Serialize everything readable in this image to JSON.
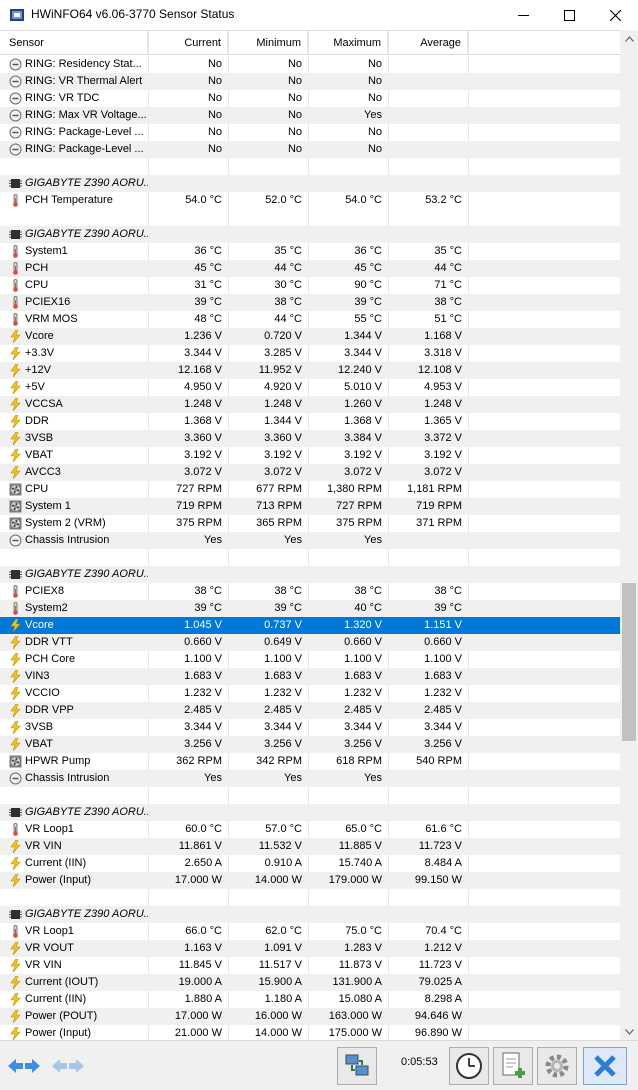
{
  "window": {
    "title": "HWiNFO64 v6.06-3770 Sensor Status"
  },
  "columns": {
    "sensor": "Sensor",
    "current": "Current",
    "minimum": "Minimum",
    "maximum": "Maximum",
    "average": "Average"
  },
  "rows": [
    {
      "type": "item",
      "icon": "status-circle-icon",
      "name": "RING: Residency Stat...",
      "cur": "No",
      "min": "No",
      "max": "No",
      "avg": ""
    },
    {
      "type": "item",
      "icon": "status-circle-icon",
      "name": "RING: VR Thermal Alert",
      "cur": "No",
      "min": "No",
      "max": "No",
      "avg": ""
    },
    {
      "type": "item",
      "icon": "status-circle-icon",
      "name": "RING: VR TDC",
      "cur": "No",
      "min": "No",
      "max": "No",
      "avg": ""
    },
    {
      "type": "item",
      "icon": "status-circle-icon",
      "name": "RING: Max VR Voltage...",
      "cur": "No",
      "min": "No",
      "max": "Yes",
      "avg": ""
    },
    {
      "type": "item",
      "icon": "status-circle-icon",
      "name": "RING: Package-Level ...",
      "cur": "No",
      "min": "No",
      "max": "No",
      "avg": ""
    },
    {
      "type": "item",
      "icon": "status-circle-icon",
      "name": "RING: Package-Level ...",
      "cur": "No",
      "min": "No",
      "max": "No",
      "avg": ""
    },
    {
      "type": "blank"
    },
    {
      "type": "group",
      "icon": "chip-icon",
      "name": "GIGABYTE Z390 AORU..."
    },
    {
      "type": "item",
      "icon": "thermometer-icon",
      "name": "PCH Temperature",
      "cur": "54.0 °C",
      "min": "52.0 °C",
      "max": "54.0 °C",
      "avg": "53.2 °C"
    },
    {
      "type": "blank"
    },
    {
      "type": "group",
      "icon": "chip-icon",
      "name": "GIGABYTE Z390 AORU..."
    },
    {
      "type": "item",
      "icon": "thermometer-icon",
      "name": "System1",
      "cur": "36 °C",
      "min": "35 °C",
      "max": "36 °C",
      "avg": "35 °C"
    },
    {
      "type": "item",
      "icon": "thermometer-icon",
      "name": "PCH",
      "cur": "45 °C",
      "min": "44 °C",
      "max": "45 °C",
      "avg": "44 °C"
    },
    {
      "type": "item",
      "icon": "thermometer-icon",
      "name": "CPU",
      "cur": "31 °C",
      "min": "30 °C",
      "max": "90 °C",
      "avg": "71 °C"
    },
    {
      "type": "item",
      "icon": "thermometer-icon",
      "name": "PCIEX16",
      "cur": "39 °C",
      "min": "38 °C",
      "max": "39 °C",
      "avg": "38 °C"
    },
    {
      "type": "item",
      "icon": "thermometer-icon",
      "name": "VRM MOS",
      "cur": "48 °C",
      "min": "44 °C",
      "max": "55 °C",
      "avg": "51 °C"
    },
    {
      "type": "item",
      "icon": "bolt-icon",
      "name": "Vcore",
      "cur": "1.236 V",
      "min": "0.720 V",
      "max": "1.344 V",
      "avg": "1.168 V"
    },
    {
      "type": "item",
      "icon": "bolt-icon",
      "name": "+3.3V",
      "cur": "3.344 V",
      "min": "3.285 V",
      "max": "3.344 V",
      "avg": "3.318 V"
    },
    {
      "type": "item",
      "icon": "bolt-icon",
      "name": "+12V",
      "cur": "12.168 V",
      "min": "11.952 V",
      "max": "12.240 V",
      "avg": "12.108 V"
    },
    {
      "type": "item",
      "icon": "bolt-icon",
      "name": "+5V",
      "cur": "4.950 V",
      "min": "4.920 V",
      "max": "5.010 V",
      "avg": "4.953 V"
    },
    {
      "type": "item",
      "icon": "bolt-icon",
      "name": "VCCSA",
      "cur": "1.248 V",
      "min": "1.248 V",
      "max": "1.260 V",
      "avg": "1.248 V"
    },
    {
      "type": "item",
      "icon": "bolt-icon",
      "name": "DDR",
      "cur": "1.368 V",
      "min": "1.344 V",
      "max": "1.368 V",
      "avg": "1.365 V"
    },
    {
      "type": "item",
      "icon": "bolt-icon",
      "name": "3VSB",
      "cur": "3.360 V",
      "min": "3.360 V",
      "max": "3.384 V",
      "avg": "3.372 V"
    },
    {
      "type": "item",
      "icon": "bolt-icon",
      "name": "VBAT",
      "cur": "3.192 V",
      "min": "3.192 V",
      "max": "3.192 V",
      "avg": "3.192 V"
    },
    {
      "type": "item",
      "icon": "bolt-icon",
      "name": "AVCC3",
      "cur": "3.072 V",
      "min": "3.072 V",
      "max": "3.072 V",
      "avg": "3.072 V"
    },
    {
      "type": "item",
      "icon": "fan-icon",
      "name": "CPU",
      "cur": "727 RPM",
      "min": "677 RPM",
      "max": "1,380 RPM",
      "avg": "1,181 RPM"
    },
    {
      "type": "item",
      "icon": "fan-icon",
      "name": "System 1",
      "cur": "719 RPM",
      "min": "713 RPM",
      "max": "727 RPM",
      "avg": "719 RPM"
    },
    {
      "type": "item",
      "icon": "fan-icon",
      "name": "System 2 (VRM)",
      "cur": "375 RPM",
      "min": "365 RPM",
      "max": "375 RPM",
      "avg": "371 RPM"
    },
    {
      "type": "item",
      "icon": "status-circle-icon",
      "name": "Chassis Intrusion",
      "cur": "Yes",
      "min": "Yes",
      "max": "Yes",
      "avg": ""
    },
    {
      "type": "blank"
    },
    {
      "type": "group",
      "icon": "chip-icon",
      "name": "GIGABYTE Z390 AORU..."
    },
    {
      "type": "item",
      "icon": "thermometer-icon",
      "name": "PCIEX8",
      "cur": "38 °C",
      "min": "38 °C",
      "max": "38 °C",
      "avg": "38 °C"
    },
    {
      "type": "item",
      "icon": "thermometer-icon",
      "name": "System2",
      "cur": "39 °C",
      "min": "39 °C",
      "max": "40 °C",
      "avg": "39 °C"
    },
    {
      "type": "item",
      "icon": "bolt-icon",
      "name": "Vcore",
      "cur": "1.045 V",
      "min": "0.737 V",
      "max": "1.320 V",
      "avg": "1.151 V",
      "selected": true
    },
    {
      "type": "item",
      "icon": "bolt-icon",
      "name": "DDR VTT",
      "cur": "0.660 V",
      "min": "0.649 V",
      "max": "0.660 V",
      "avg": "0.660 V"
    },
    {
      "type": "item",
      "icon": "bolt-icon",
      "name": "PCH Core",
      "cur": "1.100 V",
      "min": "1.100 V",
      "max": "1.100 V",
      "avg": "1.100 V"
    },
    {
      "type": "item",
      "icon": "bolt-icon",
      "name": "VIN3",
      "cur": "1.683 V",
      "min": "1.683 V",
      "max": "1.683 V",
      "avg": "1.683 V"
    },
    {
      "type": "item",
      "icon": "bolt-icon",
      "name": "VCCIO",
      "cur": "1.232 V",
      "min": "1.232 V",
      "max": "1.232 V",
      "avg": "1.232 V"
    },
    {
      "type": "item",
      "icon": "bolt-icon",
      "name": "DDR VPP",
      "cur": "2.485 V",
      "min": "2.485 V",
      "max": "2.485 V",
      "avg": "2.485 V"
    },
    {
      "type": "item",
      "icon": "bolt-icon",
      "name": "3VSB",
      "cur": "3.344 V",
      "min": "3.344 V",
      "max": "3.344 V",
      "avg": "3.344 V"
    },
    {
      "type": "item",
      "icon": "bolt-icon",
      "name": "VBAT",
      "cur": "3.256 V",
      "min": "3.256 V",
      "max": "3.256 V",
      "avg": "3.256 V"
    },
    {
      "type": "item",
      "icon": "fan-icon",
      "name": "HPWR Pump",
      "cur": "362 RPM",
      "min": "342 RPM",
      "max": "618 RPM",
      "avg": "540 RPM"
    },
    {
      "type": "item",
      "icon": "status-circle-icon",
      "name": "Chassis Intrusion",
      "cur": "Yes",
      "min": "Yes",
      "max": "Yes",
      "avg": ""
    },
    {
      "type": "blank"
    },
    {
      "type": "group",
      "icon": "chip-icon",
      "name": "GIGABYTE Z390 AORU..."
    },
    {
      "type": "item",
      "icon": "thermometer-icon",
      "name": "VR Loop1",
      "cur": "60.0 °C",
      "min": "57.0 °C",
      "max": "65.0 °C",
      "avg": "61.6 °C"
    },
    {
      "type": "item",
      "icon": "bolt-icon",
      "name": "VR VIN",
      "cur": "11.861 V",
      "min": "11.532 V",
      "max": "11.885 V",
      "avg": "11.723 V"
    },
    {
      "type": "item",
      "icon": "bolt-icon",
      "name": "Current (IIN)",
      "cur": "2.650 A",
      "min": "0.910 A",
      "max": "15.740 A",
      "avg": "8.484 A"
    },
    {
      "type": "item",
      "icon": "bolt-icon",
      "name": "Power (Input)",
      "cur": "17.000 W",
      "min": "14.000 W",
      "max": "179.000 W",
      "avg": "99.150 W"
    },
    {
      "type": "blank"
    },
    {
      "type": "group",
      "icon": "chip-icon",
      "name": "GIGABYTE Z390 AORU..."
    },
    {
      "type": "item",
      "icon": "thermometer-icon",
      "name": "VR Loop1",
      "cur": "66.0 °C",
      "min": "62.0 °C",
      "max": "75.0 °C",
      "avg": "70.4 °C"
    },
    {
      "type": "item",
      "icon": "bolt-icon",
      "name": "VR VOUT",
      "cur": "1.163 V",
      "min": "1.091 V",
      "max": "1.283 V",
      "avg": "1.212 V"
    },
    {
      "type": "item",
      "icon": "bolt-icon",
      "name": "VR VIN",
      "cur": "11.845 V",
      "min": "11.517 V",
      "max": "11.873 V",
      "avg": "11.723 V"
    },
    {
      "type": "item",
      "icon": "bolt-icon",
      "name": "Current (IOUT)",
      "cur": "19.000 A",
      "min": "15.900 A",
      "max": "131.900 A",
      "avg": "79.025 A"
    },
    {
      "type": "item",
      "icon": "bolt-icon",
      "name": "Current (IIN)",
      "cur": "1.880 A",
      "min": "1.180 A",
      "max": "15.080 A",
      "avg": "8.298 A"
    },
    {
      "type": "item",
      "icon": "bolt-icon",
      "name": "Power (POUT)",
      "cur": "17.000 W",
      "min": "16.000 W",
      "max": "163.000 W",
      "avg": "94.646 W"
    },
    {
      "type": "item",
      "icon": "bolt-icon",
      "name": "Power (Input)",
      "cur": "21.000 W",
      "min": "14.000 W",
      "max": "175.000 W",
      "avg": "96.890 W"
    }
  ],
  "toolbar": {
    "timer": "0:05:53"
  },
  "colors": {
    "selection": "#0078d7",
    "alt_row": "#f0f0f0",
    "close_button": "#2a7fd4"
  }
}
